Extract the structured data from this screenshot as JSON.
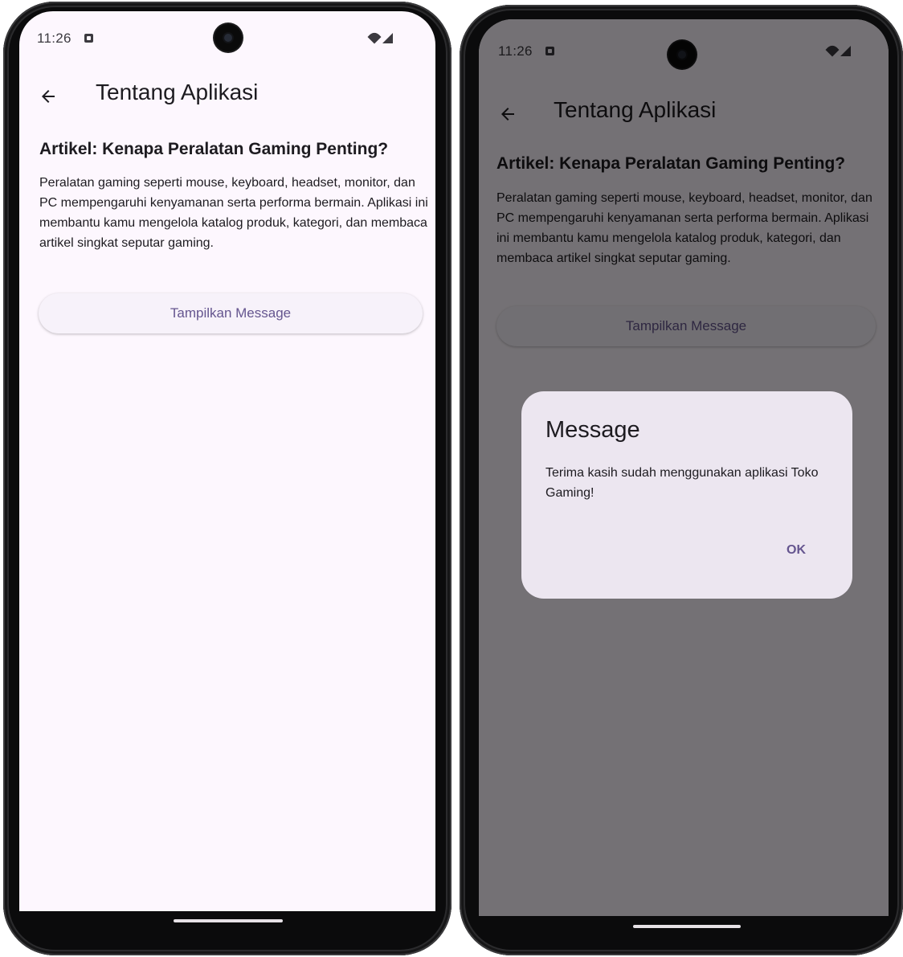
{
  "status_bar": {
    "time": "11:26"
  },
  "app_bar": {
    "title": "Tentang Aplikasi"
  },
  "article": {
    "title": "Artikel: Kenapa Peralatan Gaming Penting?",
    "body": "Peralatan gaming seperti mouse, keyboard, headset, monitor, dan PC mempengaruhi kenyamanan serta performa bermain. Aplikasi ini membantu kamu mengelola katalog produk, kategori, dan membaca artikel singkat seputar gaming."
  },
  "button": {
    "label": "Tampilkan Message"
  },
  "dialog": {
    "title": "Message",
    "body": "Terima kasih sudah menggunakan aplikasi Toko Gaming!",
    "ok_label": "OK"
  },
  "icons": {
    "back": "arrow-back-icon",
    "notification": "notification-icon",
    "wifi": "wifi-icon",
    "signal": "signal-icon",
    "camera": "front-camera"
  },
  "colors": {
    "background": "#fdf7fe",
    "primary": "#65558f",
    "button_surface": "#f7f2fa",
    "dialog_surface": "#ece6f0",
    "text": "#1d1b20",
    "scrim": "rgba(0,0,0,0.54)"
  }
}
